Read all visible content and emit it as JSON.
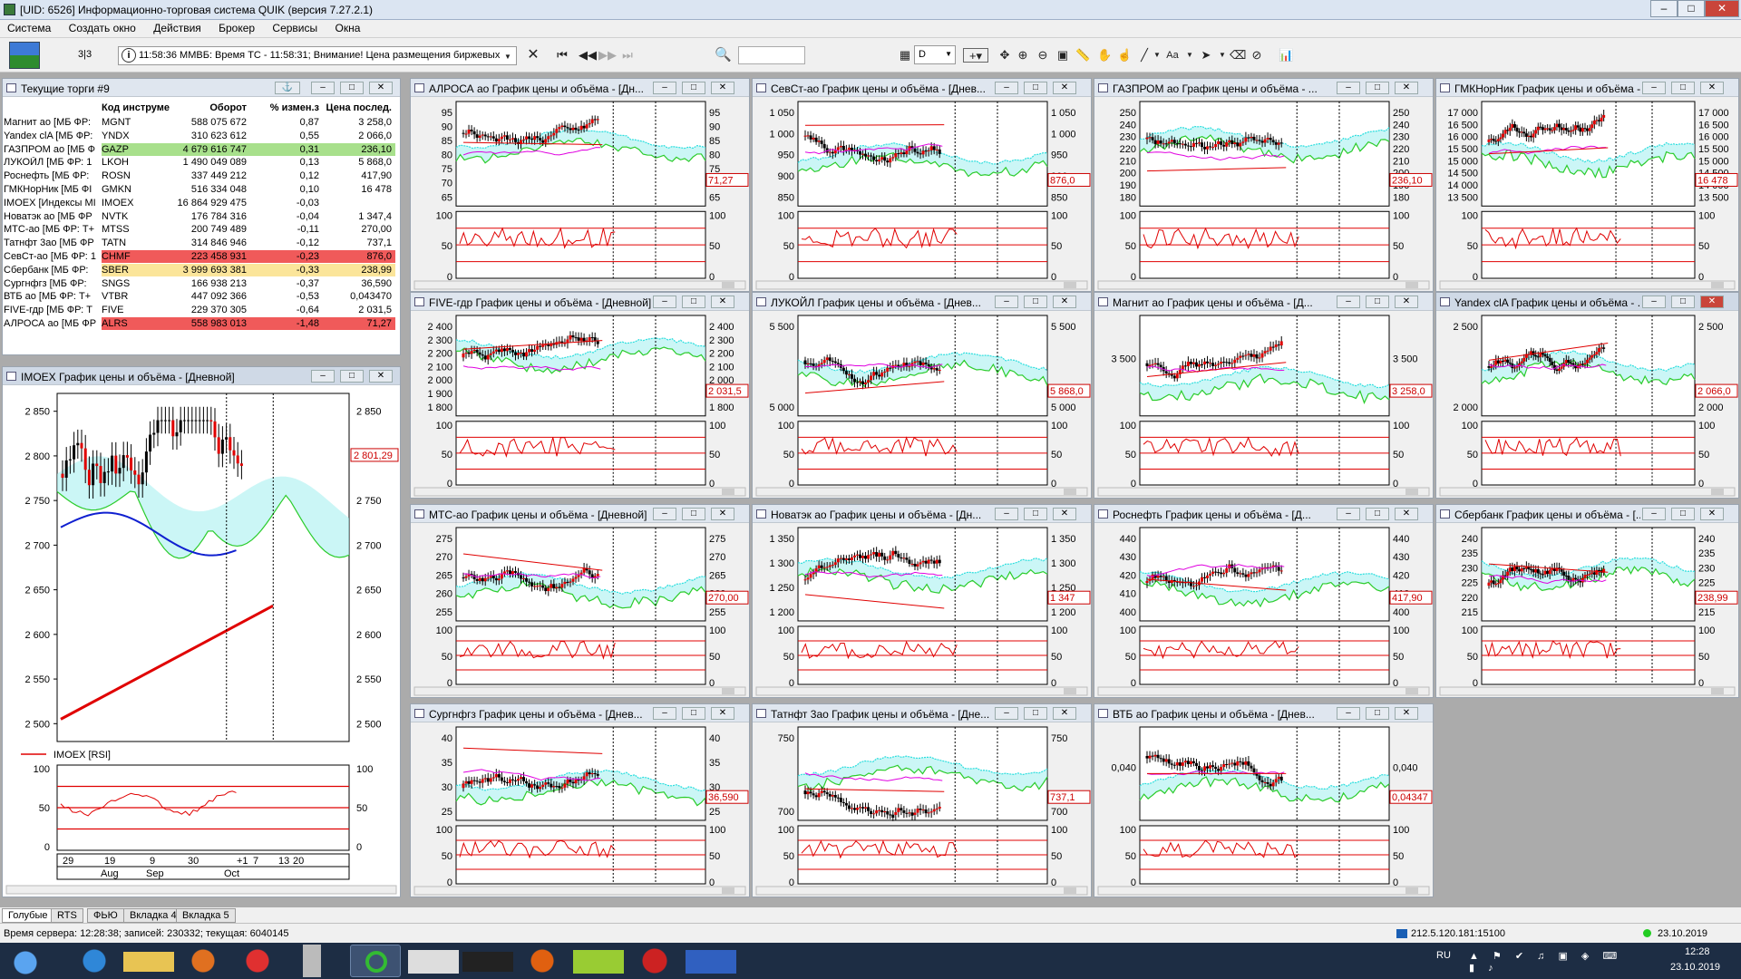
{
  "window": {
    "title": "[UID: 6526] Информационно-торговая система QUIK (версия 7.27.2.1)"
  },
  "menu": [
    "Система",
    "Создать окно",
    "Действия",
    "Брокер",
    "Сервисы",
    "Окна"
  ],
  "toolbar": {
    "page_counter": "3|3",
    "ticker": "11:58:36  ММВБ: Время ТС - 11:58:31; Внимание! Цена размещения биржевых",
    "interval": "D"
  },
  "trade_table": {
    "title": "Текущие торги #9",
    "headers": [
      "Код инструме",
      "Оборот",
      "% измен.з",
      "Цена послед."
    ],
    "rows": [
      {
        "name": "Магнит ао [МБ ФР:",
        "code": "MGNT",
        "turnover": "588 075 672",
        "change": "0,87",
        "price": "3 258,0",
        "hl": ""
      },
      {
        "name": "Yandex clA [МБ ФР:",
        "code": "YNDX",
        "turnover": "310 623 612",
        "change": "0,55",
        "price": "2 066,0",
        "hl": ""
      },
      {
        "name": "ГАЗПРОМ ао [МБ Ф",
        "code": "GAZP",
        "turnover": "4 679 616 747",
        "change": "0,31",
        "price": "236,10",
        "hl": "green"
      },
      {
        "name": "ЛУКОЙЛ [МБ ФР: 1",
        "code": "LKOH",
        "turnover": "1 490 049 089",
        "change": "0,13",
        "price": "5 868,0",
        "hl": ""
      },
      {
        "name": "Роснефть [МБ ФР:",
        "code": "ROSN",
        "turnover": "337 449 212",
        "change": "0,12",
        "price": "417,90",
        "hl": ""
      },
      {
        "name": "ГМКНорНик [МБ ФI",
        "code": "GMKN",
        "turnover": "516 334 048",
        "change": "0,10",
        "price": "16 478",
        "hl": ""
      },
      {
        "name": "IMOEX [Индексы МI",
        "code": "IMOEX",
        "turnover": "16 864 929 475",
        "change": "-0,03",
        "price": "",
        "hl": ""
      },
      {
        "name": "Новатэк ао [МБ ФР",
        "code": "NVTK",
        "turnover": "176 784 316",
        "change": "-0,04",
        "price": "1 347,4",
        "hl": ""
      },
      {
        "name": "МТС-ао [МБ ФР: Т+",
        "code": "MTSS",
        "turnover": "200 749 489",
        "change": "-0,11",
        "price": "270,00",
        "hl": ""
      },
      {
        "name": "Татнфт 3ао [МБ ФР",
        "code": "TATN",
        "turnover": "314 846 946",
        "change": "-0,12",
        "price": "737,1",
        "hl": ""
      },
      {
        "name": "СевСт-ао [МБ ФР: 1",
        "code": "CHMF",
        "turnover": "223 458 931",
        "change": "-0,23",
        "price": "876,0",
        "hl": "red"
      },
      {
        "name": "Сбербанк [МБ ФР:",
        "code": "SBER",
        "turnover": "3 999 693 381",
        "change": "-0,33",
        "price": "238,99",
        "hl": "yellow"
      },
      {
        "name": "Сургнфгз [МБ ФР:",
        "code": "SNGS",
        "turnover": "166 938 213",
        "change": "-0,37",
        "price": "36,590",
        "hl": ""
      },
      {
        "name": "ВТБ ао [МБ ФР: Т+",
        "code": "VTBR",
        "turnover": "447 092 366",
        "change": "-0,53",
        "price": "0,043470",
        "hl": ""
      },
      {
        "name": "FIVE-гдр [МБ ФР: Т",
        "code": "FIVE",
        "turnover": "229 370 305",
        "change": "-0,64",
        "price": "2 031,5",
        "hl": ""
      },
      {
        "name": "АЛРОСА ао [МБ ФР",
        "code": "ALRS",
        "turnover": "558 983 013",
        "change": "-1,48",
        "price": "71,27",
        "hl": "red"
      }
    ]
  },
  "imoex": {
    "title": "IMOEX График цены и объёма - [Дневной]",
    "ticks": [
      "2 850",
      "2 800",
      "2 750",
      "2 700",
      "2 650",
      "2 600",
      "2 550",
      "2 500"
    ],
    "last": "2 801,29",
    "rsi_label": "IMOEX [RSI]",
    "rsi_ticks": [
      "100",
      "50",
      "0"
    ],
    "x_days": [
      "29",
      "19",
      "9",
      "30",
      "+1",
      "7",
      "13",
      "20"
    ],
    "x_months": [
      "Aug",
      "Sep",
      "Oct"
    ]
  },
  "chart_data": [
    {
      "type": "line",
      "title": "IMOEX График цены и объёма - [Дневной]",
      "ylim": [
        2500,
        2850
      ],
      "x": [
        "29 Aug",
        "19 Sep",
        "9 Oct",
        "30 Oct"
      ],
      "last": 2801.29
    },
    {
      "type": "line",
      "title": "АЛРОСА ао График цены и объёма - [Дн...",
      "ylim": [
        65,
        95
      ],
      "last": 71.27
    },
    {
      "type": "line",
      "title": "СевСт-ао График цены и объёма - [Днев...",
      "ylim": [
        850,
        1050
      ],
      "last": 876.0
    },
    {
      "type": "line",
      "title": "ГАЗПРОМ ао График цены и объёма - ...",
      "ylim": [
        180,
        250
      ],
      "last": 236.1
    },
    {
      "type": "line",
      "title": "ГМКНорНик График цены и объёма - ...",
      "ylim": [
        13500,
        17000
      ],
      "last": 16478
    },
    {
      "type": "line",
      "title": "FIVE-гдр График цены и объёма - [Дневной]",
      "ylim": [
        1800,
        2400
      ],
      "last": 2031.5
    },
    {
      "type": "line",
      "title": "ЛУКОЙЛ График цены и объёма - [Днев...",
      "ylim": [
        5000,
        5868
      ],
      "last": 5868.0
    },
    {
      "type": "line",
      "title": "Магнит ао График цены и объёма - [Д...",
      "ylim": [
        3258,
        3500
      ],
      "last": 3258.0
    },
    {
      "type": "line",
      "title": "Yandex clA График цены и объёма - ...",
      "ylim": [
        2000,
        2500
      ],
      "last": 2066.0
    },
    {
      "type": "line",
      "title": "МТС-ао График цены и объёма - [Дневной]",
      "ylim": [
        255,
        275
      ],
      "last": 270.0
    },
    {
      "type": "line",
      "title": "Новатэк ао График цены и объёма - [Дн...",
      "ylim": [
        1200,
        1350
      ],
      "last": 1347
    },
    {
      "type": "line",
      "title": "Роснефть График цены и объёма - [Д...",
      "ylim": [
        400,
        440
      ],
      "last": 417.9
    },
    {
      "type": "line",
      "title": "Сбербанк График цены и объёма - [...",
      "ylim": [
        215,
        240
      ],
      "last": 238.99
    },
    {
      "type": "line",
      "title": "Сургнфгз График цены и объёма - [Днев...",
      "ylim": [
        25,
        40
      ],
      "last": 36.59
    },
    {
      "type": "line",
      "title": "Татнфт 3ао График цены и объёма - [Дне...",
      "ylim": [
        700,
        750
      ],
      "last": 737.1
    },
    {
      "type": "line",
      "title": "ВТБ ао График цены и объёма - [Днев...",
      "ylim": [
        0.04,
        0.043
      ],
      "last": 0.04347
    }
  ],
  "charts": [
    {
      "title": "АЛРОСА ао График цены и объёма - [Дн...",
      "ticks": [
        "95",
        "90",
        "85",
        "80",
        "75",
        "70",
        "65"
      ],
      "last": "71,27"
    },
    {
      "title": "СевСт-ао График цены и объёма - [Днев...",
      "ticks": [
        "1 050",
        "1 000",
        "950",
        "900",
        "850"
      ],
      "last": "876,0"
    },
    {
      "title": "ГАЗПРОМ ао График цены и объёма - ...",
      "ticks": [
        "250",
        "240",
        "230",
        "220",
        "210",
        "200",
        "190",
        "180"
      ],
      "last": "236,10"
    },
    {
      "title": "ГМКНорНик График цены и объёма - ...",
      "ticks": [
        "17 000",
        "16 500",
        "16 000",
        "15 500",
        "15 000",
        "14 500",
        "14 000",
        "13 500"
      ],
      "last": "16 478"
    },
    {
      "title": "FIVE-гдр График цены и объёма - [Дневной]",
      "ticks": [
        "2 400",
        "2 300",
        "2 200",
        "2 100",
        "2 000",
        "1 900",
        "1 800"
      ],
      "last": "2 031,5"
    },
    {
      "title": "ЛУКОЙЛ График цены и объёма - [Днев...",
      "ticks": [
        "5 500",
        "5 000"
      ],
      "last": "5 868,0"
    },
    {
      "title": "Магнит ао График цены и объёма - [Д...",
      "ticks": [
        "3 500"
      ],
      "last": "3 258,0"
    },
    {
      "title": "Yandex clA График цены и объёма - ...",
      "ticks": [
        "2 500",
        "2 000"
      ],
      "last": "2 066,0"
    },
    {
      "title": "МТС-ао График цены и объёма - [Дневной]",
      "ticks": [
        "275",
        "270",
        "265",
        "260",
        "255"
      ],
      "last": "270,00"
    },
    {
      "title": "Новатэк ао График цены и объёма - [Дн...",
      "ticks": [
        "1 350",
        "1 300",
        "1 250",
        "1 200"
      ],
      "last": "1 347"
    },
    {
      "title": "Роснефть График цены и объёма - [Д...",
      "ticks": [
        "440",
        "430",
        "420",
        "410",
        "400"
      ],
      "last": "417,90"
    },
    {
      "title": "Сбербанк График цены и объёма - [...",
      "ticks": [
        "240",
        "235",
        "230",
        "225",
        "220",
        "215"
      ],
      "last": "238,99"
    },
    {
      "title": "Сургнфгз График цены и объёма - [Днев...",
      "ticks": [
        "40",
        "35",
        "30",
        "25"
      ],
      "last": "36,590"
    },
    {
      "title": "Татнфт 3ао График цены и объёма - [Дне...",
      "ticks": [
        "750",
        "700"
      ],
      "last": "737,1"
    },
    {
      "title": "ВТБ ао График цены и объёма - [Днев...",
      "ticks": [
        "0,040"
      ],
      "last": "0,04347"
    }
  ],
  "rsi_ticks": [
    "100",
    "50",
    "0"
  ],
  "tabs": [
    "Голубые",
    "RTS",
    "ФЬЮ",
    "Вкладка 4",
    "Вкладка 5"
  ],
  "status": {
    "server": "Время сервера: 12:28:38; записей: 230332; текущая: 6040145",
    "ip": "212.5.120.181:15100",
    "date": "23.10.2019"
  },
  "taskbar": {
    "lang": "RU",
    "time": "12:28",
    "date": "23.10.2019"
  },
  "colors": {
    "red_row": "#f05a5a",
    "green_row": "#a8e08c",
    "yellow_row": "#fbe59a",
    "price_line": "#e00000",
    "ichimoku_cloud": "#2adede",
    "ichimoku_green": "#2bcc2b"
  }
}
